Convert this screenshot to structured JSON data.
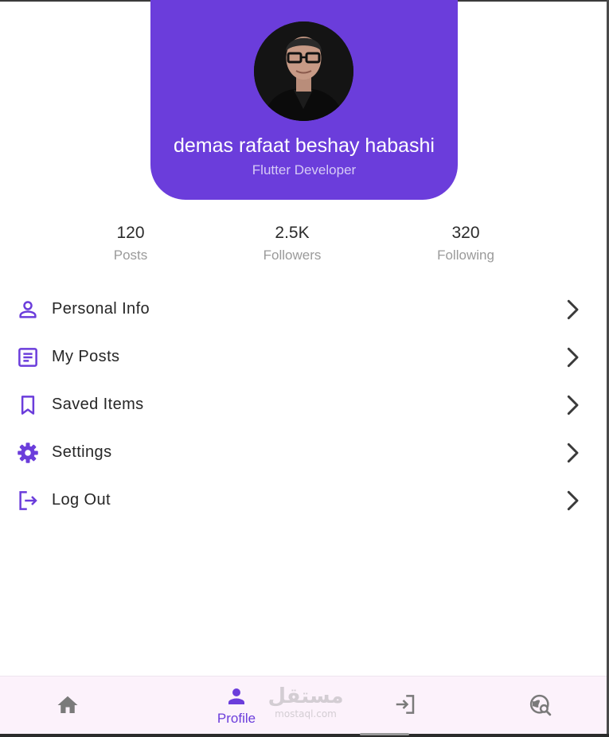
{
  "profile": {
    "name": "demas rafaat beshay habashi",
    "role": "Flutter Developer",
    "avatar_icon": "profile-photo"
  },
  "stats": [
    {
      "value": "120",
      "label": "Posts"
    },
    {
      "value": "2.5K",
      "label": "Followers"
    },
    {
      "value": "320",
      "label": "Following"
    }
  ],
  "menu": [
    {
      "label": "Personal Info",
      "icon": "person-icon"
    },
    {
      "label": "My Posts",
      "icon": "article-icon"
    },
    {
      "label": "Saved Items",
      "icon": "bookmark-icon"
    },
    {
      "label": "Settings",
      "icon": "gear-icon"
    },
    {
      "label": "Log Out",
      "icon": "logout-icon"
    }
  ],
  "bottom_nav": {
    "items": [
      {
        "icon": "home-icon",
        "label": ""
      },
      {
        "icon": "person-icon",
        "label": "Profile",
        "active": true
      },
      {
        "icon": "login-icon",
        "label": ""
      },
      {
        "icon": "travel-explore-icon",
        "label": ""
      }
    ]
  },
  "watermark": {
    "main": "مستقل",
    "sub": "mostaql.com"
  },
  "colors": {
    "accent": "#6b3ddb",
    "nav_background": "#fcf2fb",
    "inactive_icon": "#7a7a7a",
    "text": "#262626",
    "muted": "#9a9a9a"
  }
}
